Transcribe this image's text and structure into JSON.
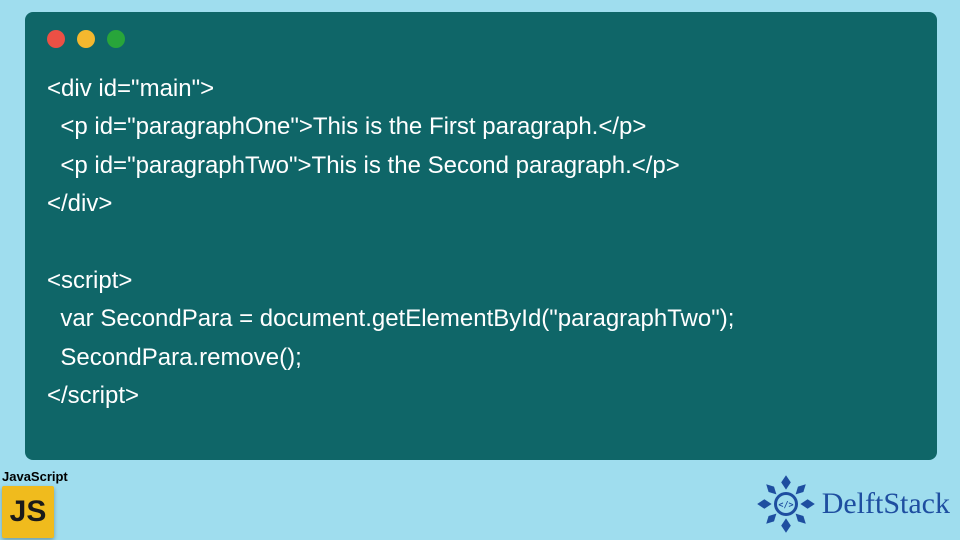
{
  "code_lines": [
    "<div id=\"main\">",
    "  <p id=\"paragraphOne\">This is the First paragraph.</p>",
    "  <p id=\"paragraphTwo\">This is the Second paragraph.</p>",
    "</div>",
    "",
    "<script>",
    "  var SecondPara = document.getElementById(\"paragraphTwo\");",
    "  SecondPara.remove();",
    "</script>"
  ],
  "badge": {
    "label": "JavaScript",
    "icon_text": "JS"
  },
  "brand": {
    "name": "DelftStack"
  },
  "colors": {
    "page_bg": "#9fddee",
    "window_bg": "#0f6668",
    "js_icon_bg": "#f0bb1d",
    "brand_color": "#1e4ea0"
  }
}
